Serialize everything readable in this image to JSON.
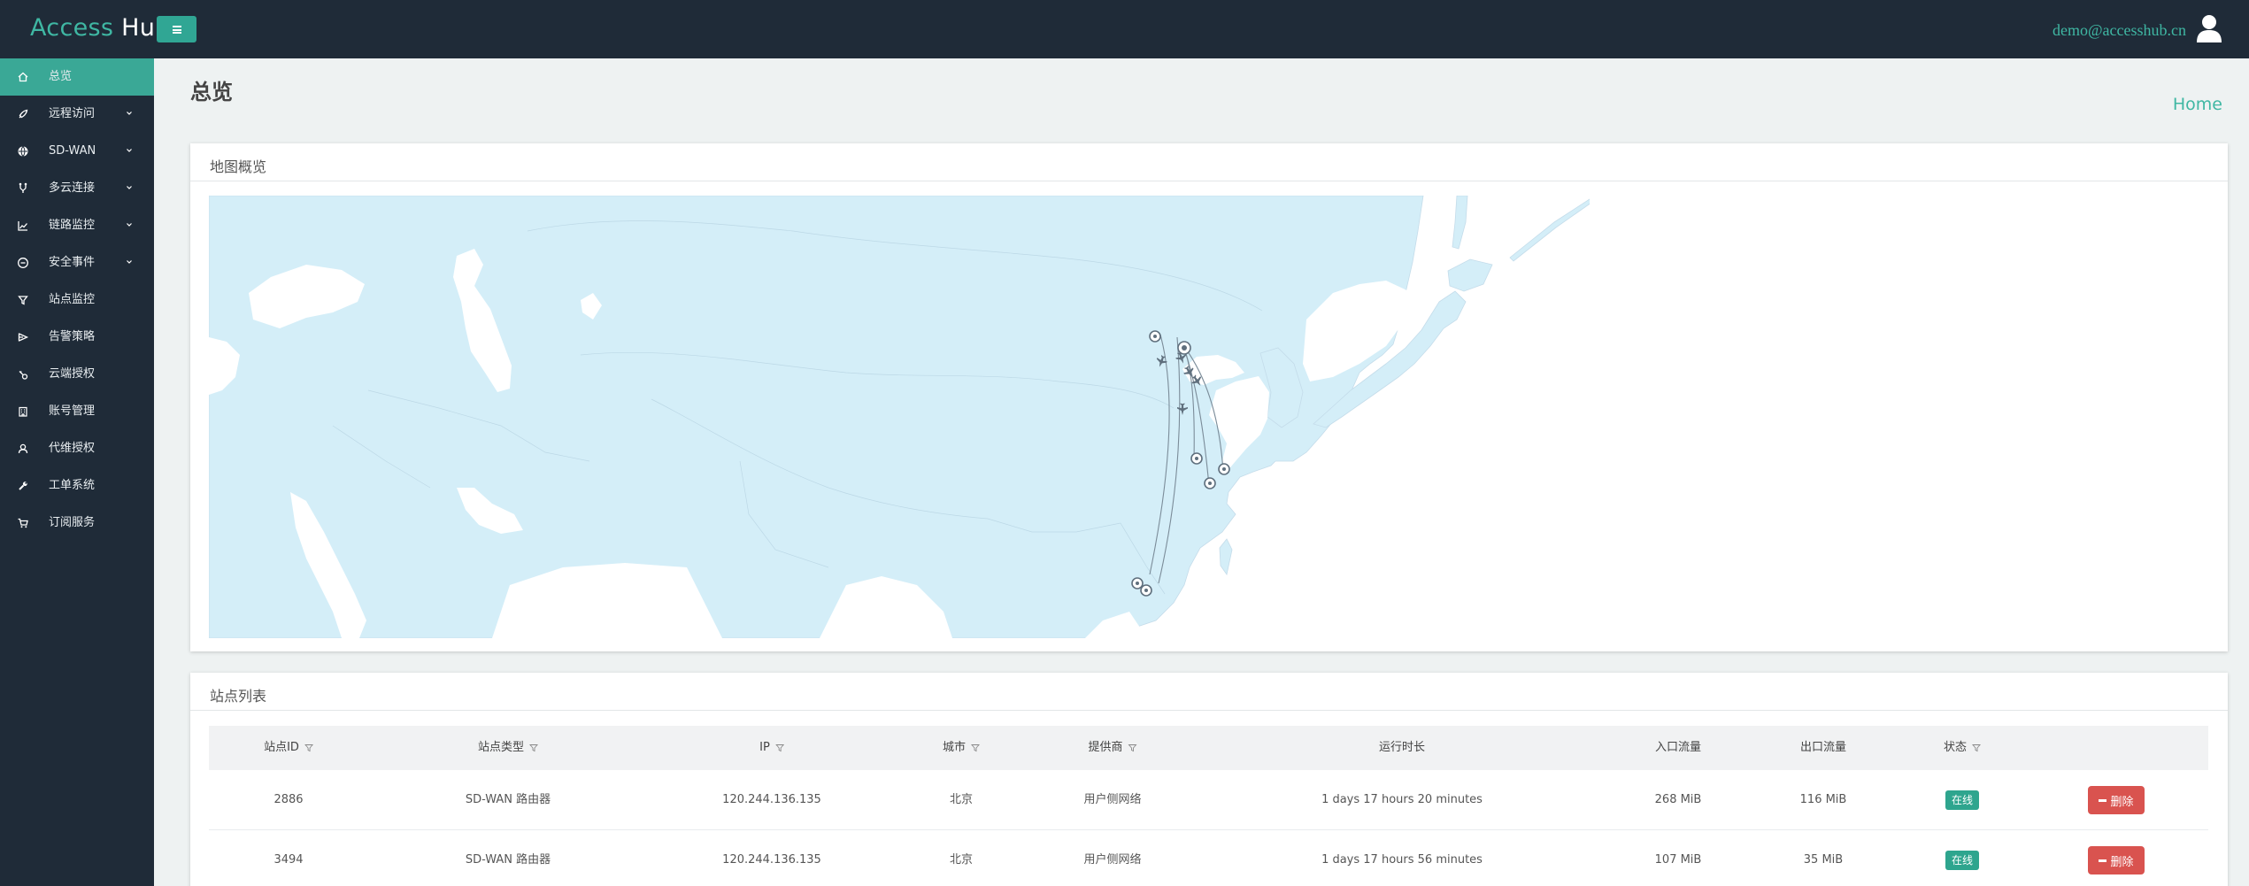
{
  "brand": {
    "part1": "Access",
    "part2": "Hub"
  },
  "header": {
    "user_email": "demo@accesshub.cn",
    "colors": {
      "bar": "#1f2b38",
      "accent": "#3fb7a3"
    }
  },
  "sidebar": {
    "items": [
      {
        "label": "总览",
        "icon": "home-icon",
        "active": true,
        "has_children": false
      },
      {
        "label": "远程访问",
        "icon": "rocket-icon",
        "active": false,
        "has_children": true
      },
      {
        "label": "SD-WAN",
        "icon": "globe-icon",
        "active": false,
        "has_children": true
      },
      {
        "label": "多云连接",
        "icon": "branch-icon",
        "active": false,
        "has_children": true
      },
      {
        "label": "链路监控",
        "icon": "chart-line-icon",
        "active": false,
        "has_children": true
      },
      {
        "label": "安全事件",
        "icon": "minus-circle-icon",
        "active": false,
        "has_children": true
      },
      {
        "label": "站点监控",
        "icon": "filter-icon",
        "active": false,
        "has_children": false
      },
      {
        "label": "告警策略",
        "icon": "send-icon",
        "active": false,
        "has_children": false
      },
      {
        "label": "云端授权",
        "icon": "key-icon",
        "active": false,
        "has_children": false
      },
      {
        "label": "账号管理",
        "icon": "building-icon",
        "active": false,
        "has_children": false
      },
      {
        "label": "代维授权",
        "icon": "user-icon",
        "active": false,
        "has_children": false
      },
      {
        "label": "工单系统",
        "icon": "wrench-icon",
        "active": false,
        "has_children": false
      },
      {
        "label": "订阅服务",
        "icon": "cart-icon",
        "active": false,
        "has_children": false
      }
    ]
  },
  "page": {
    "title": "总览",
    "breadcrumb": "Home"
  },
  "map_card": {
    "title": "地图概览"
  },
  "table_card": {
    "title": "站点列表",
    "columns": [
      {
        "label": "站点ID",
        "filter": true
      },
      {
        "label": "站点类型",
        "filter": true
      },
      {
        "label": "IP",
        "filter": true
      },
      {
        "label": "城市",
        "filter": true
      },
      {
        "label": "提供商",
        "filter": true
      },
      {
        "label": "运行时长",
        "filter": false
      },
      {
        "label": "入口流量",
        "filter": false
      },
      {
        "label": "出口流量",
        "filter": false
      },
      {
        "label": "状态",
        "filter": true
      }
    ],
    "rows": [
      {
        "id": "2886",
        "type": "SD-WAN 路由器",
        "ip": "120.244.136.135",
        "city": "北京",
        "provider": "用户侧网络",
        "uptime": "1 days 17 hours 20 minutes",
        "in": "268 MiB",
        "out": "116 MiB",
        "status": "在线",
        "action": "删除"
      },
      {
        "id": "3494",
        "type": "SD-WAN 路由器",
        "ip": "120.244.136.135",
        "city": "北京",
        "provider": "用户侧网络",
        "uptime": "1 days 17 hours 56 minutes",
        "in": "107 MiB",
        "out": "35 MiB",
        "status": "在线",
        "action": "删除"
      }
    ]
  }
}
